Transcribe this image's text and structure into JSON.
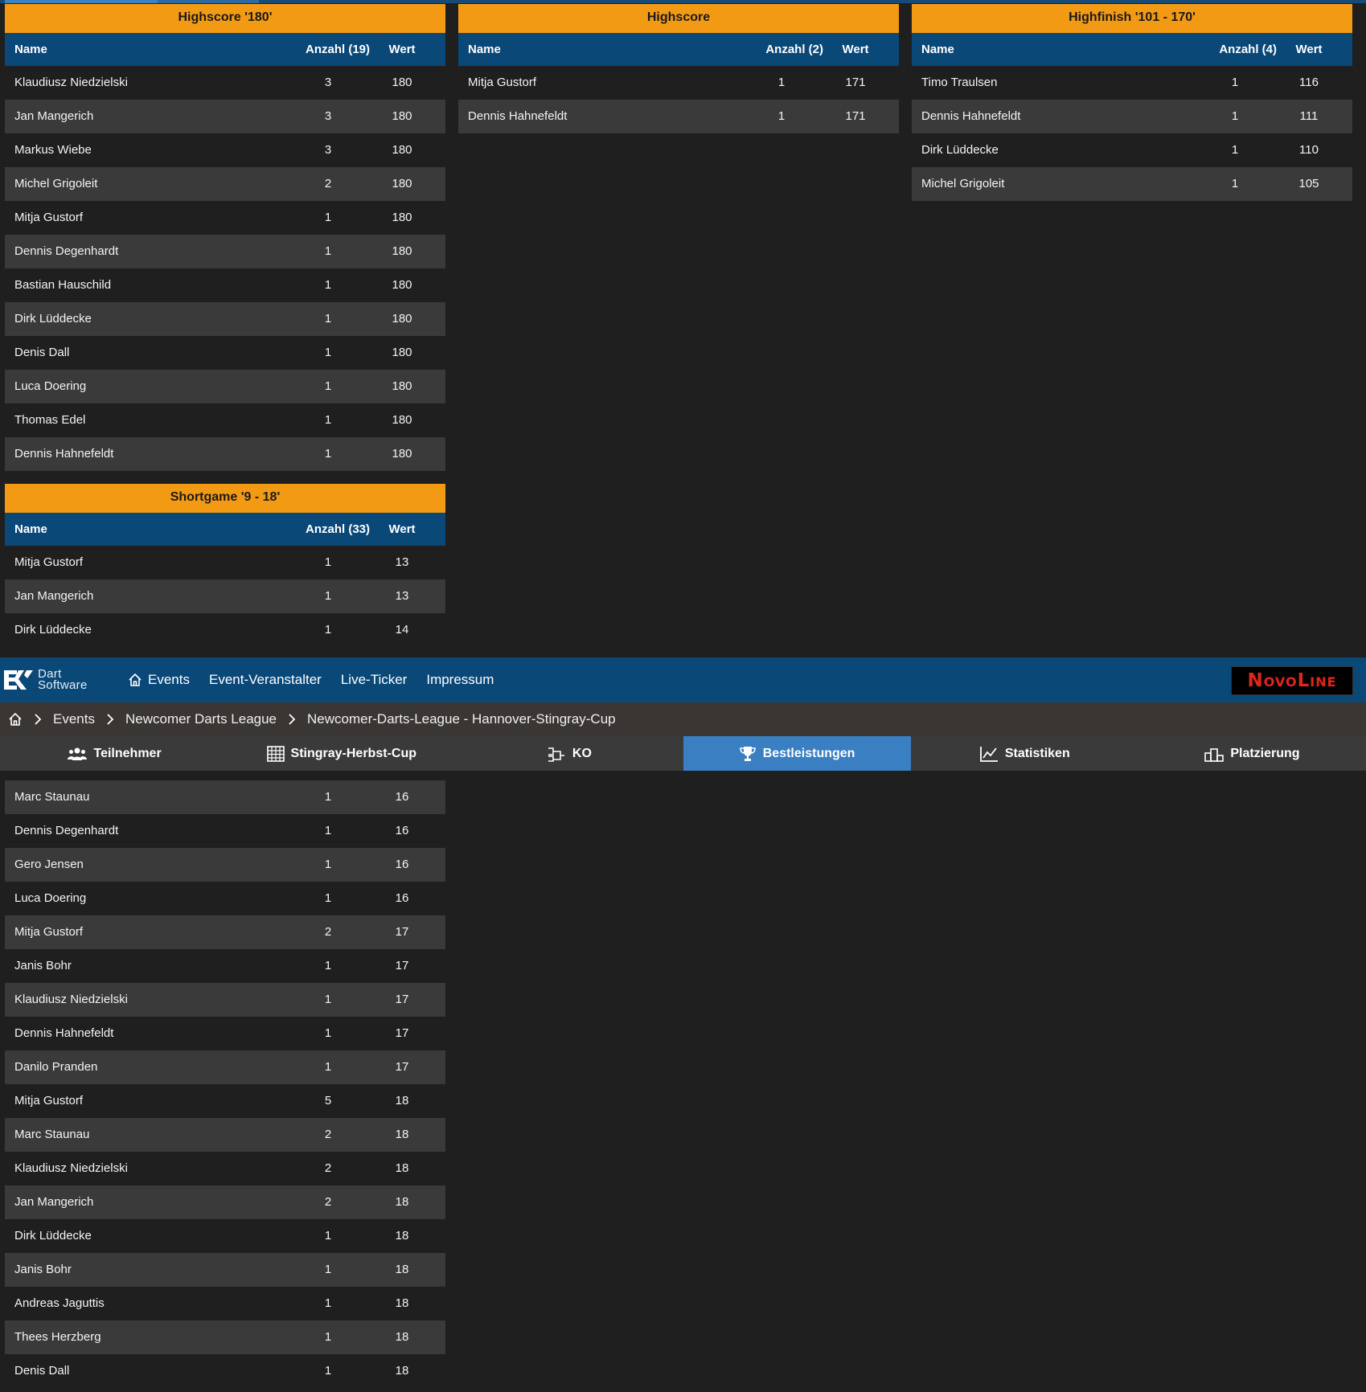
{
  "tables": {
    "highscore180": {
      "title": "Highscore '180'",
      "col_name": "Name",
      "col_count": "Anzahl (19)",
      "col_value": "Wert",
      "rows": [
        {
          "name": "Klaudiusz Niedzielski",
          "count": "3",
          "value": "180"
        },
        {
          "name": "Jan Mangerich",
          "count": "3",
          "value": "180"
        },
        {
          "name": "Markus Wiebe",
          "count": "3",
          "value": "180"
        },
        {
          "name": "Michel Grigoleit",
          "count": "2",
          "value": "180"
        },
        {
          "name": "Mitja Gustorf",
          "count": "1",
          "value": "180"
        },
        {
          "name": "Dennis Degenhardt",
          "count": "1",
          "value": "180"
        },
        {
          "name": "Bastian Hauschild",
          "count": "1",
          "value": "180"
        },
        {
          "name": "Dirk Lüddecke",
          "count": "1",
          "value": "180"
        },
        {
          "name": "Denis Dall",
          "count": "1",
          "value": "180"
        },
        {
          "name": "Luca Doering",
          "count": "1",
          "value": "180"
        },
        {
          "name": "Thomas Edel",
          "count": "1",
          "value": "180"
        },
        {
          "name": "Dennis Hahnefeldt",
          "count": "1",
          "value": "180"
        }
      ]
    },
    "highscore": {
      "title": "Highscore",
      "col_name": "Name",
      "col_count": "Anzahl (2)",
      "col_value": "Wert",
      "rows": [
        {
          "name": "Mitja Gustorf",
          "count": "1",
          "value": "171"
        },
        {
          "name": "Dennis Hahnefeldt",
          "count": "1",
          "value": "171"
        }
      ]
    },
    "highfinish": {
      "title": "Highfinish '101 - 170'",
      "col_name": "Name",
      "col_count": "Anzahl (4)",
      "col_value": "Wert",
      "rows": [
        {
          "name": "Timo Traulsen",
          "count": "1",
          "value": "116"
        },
        {
          "name": "Dennis Hahnefeldt",
          "count": "1",
          "value": "111"
        },
        {
          "name": "Dirk Lüddecke",
          "count": "1",
          "value": "110"
        },
        {
          "name": "Michel Grigoleit",
          "count": "1",
          "value": "105"
        }
      ]
    },
    "shortgame": {
      "title": "Shortgame '9 - 18'",
      "col_name": "Name",
      "col_count": "Anzahl (33)",
      "col_value": "Wert",
      "rows": [
        {
          "name": "Mitja Gustorf",
          "count": "1",
          "value": "13"
        },
        {
          "name": "Jan Mangerich",
          "count": "1",
          "value": "13"
        },
        {
          "name": "Dirk Lüddecke",
          "count": "1",
          "value": "14"
        }
      ],
      "rows_continued": [
        {
          "name": "Marc Staunau",
          "count": "1",
          "value": "16"
        },
        {
          "name": "Dennis Degenhardt",
          "count": "1",
          "value": "16"
        },
        {
          "name": "Gero Jensen",
          "count": "1",
          "value": "16"
        },
        {
          "name": "Luca Doering",
          "count": "1",
          "value": "16"
        },
        {
          "name": "Mitja Gustorf",
          "count": "2",
          "value": "17"
        },
        {
          "name": "Janis Bohr",
          "count": "1",
          "value": "17"
        },
        {
          "name": "Klaudiusz Niedzielski",
          "count": "1",
          "value": "17"
        },
        {
          "name": "Dennis Hahnefeldt",
          "count": "1",
          "value": "17"
        },
        {
          "name": "Danilo Pranden",
          "count": "1",
          "value": "17"
        },
        {
          "name": "Mitja Gustorf",
          "count": "5",
          "value": "18"
        },
        {
          "name": "Marc Staunau",
          "count": "2",
          "value": "18"
        },
        {
          "name": "Klaudiusz Niedzielski",
          "count": "2",
          "value": "18"
        },
        {
          "name": "Jan Mangerich",
          "count": "2",
          "value": "18"
        },
        {
          "name": "Dirk Lüddecke",
          "count": "1",
          "value": "18"
        },
        {
          "name": "Janis Bohr",
          "count": "1",
          "value": "18"
        },
        {
          "name": "Andreas Jaguttis",
          "count": "1",
          "value": "18"
        },
        {
          "name": "Thees Herzberg",
          "count": "1",
          "value": "18"
        },
        {
          "name": "Denis Dall",
          "count": "1",
          "value": "18"
        }
      ]
    }
  },
  "navbar": {
    "logo_line1": "Dart",
    "logo_line2": "Software",
    "logo_icon": "dart-software-logo-icon",
    "items": [
      {
        "label": "Events",
        "icon": "home-icon"
      },
      {
        "label": "Event-Veranstalter"
      },
      {
        "label": "Live-Ticker"
      },
      {
        "label": "Impressum"
      }
    ],
    "sponsor": "NovoLine"
  },
  "breadcrumb": {
    "home_icon": "home-icon",
    "items": [
      "Events",
      "Newcomer Darts League",
      "Newcomer-Darts-League - Hannover-Stingray-Cup"
    ]
  },
  "tabs": [
    {
      "label": "Teilnehmer",
      "icon": "users-icon"
    },
    {
      "label": "Stingray-Herbst-Cup",
      "icon": "table-icon"
    },
    {
      "label": "KO",
      "icon": "bracket-icon"
    },
    {
      "label": "Bestleistungen",
      "icon": "trophy-icon",
      "active": true
    },
    {
      "label": "Statistiken",
      "icon": "line-chart-icon"
    },
    {
      "label": "Platzierung",
      "icon": "podium-icon"
    }
  ],
  "colors": {
    "title_bar": "#f39a15",
    "header_bar": "#0a4878",
    "row_alt": "#3a3a3a",
    "background": "#1f1f1f",
    "active_tab": "#3a7fc2",
    "sponsor_text": "#e3241b"
  }
}
